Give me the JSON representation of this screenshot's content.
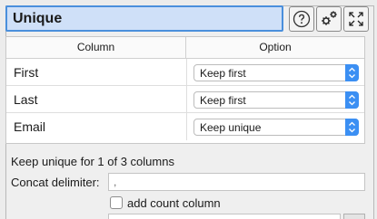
{
  "header": {
    "title": "Unique",
    "help_icon": "help-icon",
    "settings_icon": "gears-icon",
    "expand_icon": "expand-icon"
  },
  "table": {
    "headers": [
      "Column",
      "Option"
    ],
    "rows": [
      {
        "column": "First",
        "option": "Keep first"
      },
      {
        "column": "Last",
        "option": "Keep first"
      },
      {
        "column": "Email",
        "option": "Keep unique"
      }
    ]
  },
  "summary": "Keep unique for 1 of 3 columns",
  "concat": {
    "label": "Concat delimiter:",
    "value": ","
  },
  "count_column": {
    "label": "add count column",
    "checked": false
  },
  "colors": {
    "title_bg": "#cfe0f8",
    "title_border": "#4a8fdc",
    "select_arrow": "#3b8ff3"
  }
}
